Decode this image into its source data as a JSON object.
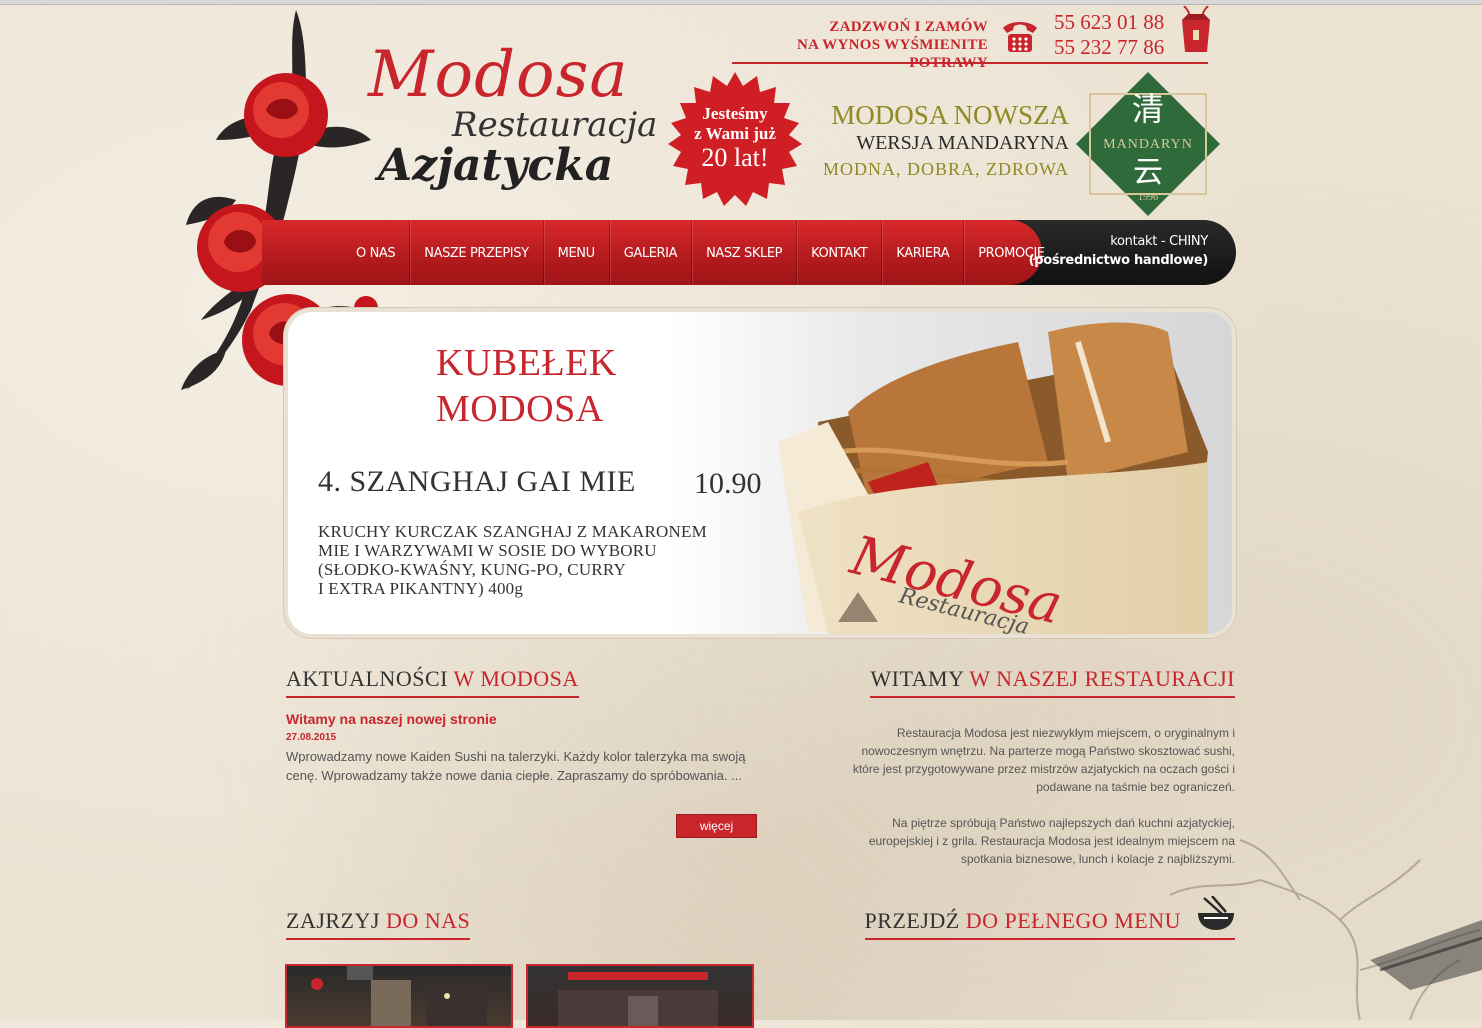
{
  "header": {
    "logo": {
      "line1": "Modosa",
      "line2": "Restauracja",
      "line3": "Azjatycka"
    },
    "call": {
      "line1": "ZADZWOŃ I ZAMÓW",
      "line2": "NA WYNOS WYŚMIENITE POTRAWY"
    },
    "phones": [
      "55 623 01 88",
      "55 232 77 86"
    ],
    "badge": {
      "line1": "Jesteśmy",
      "line2": "z Wami już",
      "line3": "20 lat!"
    },
    "mandaryn": {
      "line1": "MODOSA NOWSZA",
      "line2": "WERSJA MANDARYNA",
      "line3": "MODNA, DOBRA, ZDROWA",
      "logo_text": "MANDARYN",
      "logo_year": "1996",
      "logo_char_top": "清",
      "logo_char_bottom": "云"
    }
  },
  "nav": {
    "items": [
      "O NAS",
      "NASZE PRZEPISY",
      "MENU",
      "GALERIA",
      "NASZ SKLEP",
      "KONTAKT",
      "KARIERA",
      "PROMOCJE"
    ],
    "right_line1": "kontakt - CHINY",
    "right_line2": "(pośrednictwo handlowe)"
  },
  "banner": {
    "title_line1": "KUBEŁEK",
    "title_line2": "MODOSA",
    "dish_name": "4. SZANGHAJ GAI MIE",
    "dish_price": "10.90",
    "desc": [
      "KRUCHY KURCZAK SZANGHAJ Z MAKARONEM",
      "MIE I WARZYWAMI W SOSIE DO WYBORU",
      "(SŁODKO-KWAŚNY, KUNG-PO, CURRY",
      "I EXTRA PIKANTNY) 400g"
    ],
    "box_text1": "Modosa",
    "box_text2": "Restauracja"
  },
  "news": {
    "heading_plain": "AKTUALNOŚCI ",
    "heading_hl": "W MODOSA",
    "title": "Witamy na naszej nowej stronie",
    "date": "27.08.2015",
    "body": "Wprowadzamy nowe Kaiden Sushi na talerzyki. Każdy kolor talerzyka ma swoją cenę. Wprowadzamy także nowe dania ciepłe. Zapraszamy do spróbowania. ...",
    "more": "więcej"
  },
  "welcome": {
    "heading_plain": "WITAMY ",
    "heading_hl": "W NASZEJ RESTAURACJI",
    "p1": "Restauracja Modosa jest niezwykłym miejscem, o oryginalnym i nowoczesnym wnętrzu. Na parterze mogą Państwo skosztować sushi, które jest przygotowywane przez mistrzów azjatyckich na oczach gości i podawane na taśmie bez ograniczeń.",
    "p2": "Na piętrze spróbują Państwo najlepszych dań kuchni azjatyckiej, europejskiej i z grila. Restauracja Modosa jest idealnym miejscem na spotkania biznesowe, lunch i kolacje z najbliższymi."
  },
  "look": {
    "heading_plain": "ZAJRZYJ ",
    "heading_hl": "DO NAS"
  },
  "fullmenu": {
    "heading_plain": "PRZEJDŹ ",
    "heading_hl": "DO PEŁNEGO MENU"
  },
  "colors": {
    "accent": "#c8262c",
    "olive": "#8f8a25",
    "green": "#2e6a3a",
    "dark": "#1a1a1a"
  }
}
